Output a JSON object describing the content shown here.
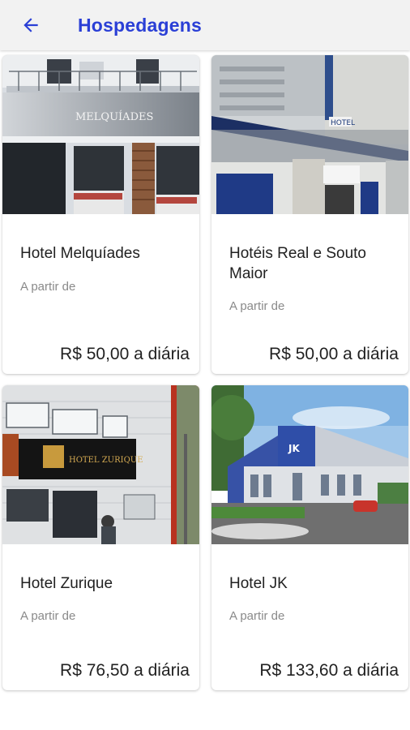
{
  "header": {
    "title": "Hospedagens",
    "back_icon": "arrow-left-icon",
    "title_color": "#2a3fd6"
  },
  "hotels": [
    {
      "name": "Hotel Melquíades",
      "from_label": "A partir de",
      "price": "R$ 50,00 a diária",
      "sign_text": "MELQUÍADES"
    },
    {
      "name": "Hotéis Real e Souto Maior",
      "from_label": "A partir de",
      "price": "R$ 50,00 a diária",
      "sign_text": "HOTEL"
    },
    {
      "name": "Hotel Zurique",
      "from_label": "A partir de",
      "price": "R$ 76,50 a diária",
      "sign_text": "HOTEL ZURIQUE"
    },
    {
      "name": "Hotel JK",
      "from_label": "A partir de",
      "price": "R$ 133,60 a diária",
      "sign_text": "JK"
    }
  ]
}
